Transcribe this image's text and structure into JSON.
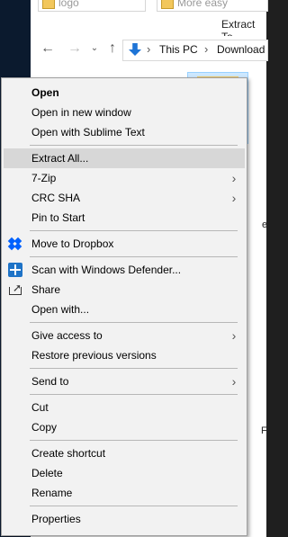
{
  "explorer": {
    "top_files": [
      "logo",
      "More easy"
    ],
    "extract_label": "Extract To",
    "address_crumbs": [
      "This PC",
      "Download"
    ],
    "right_edge_letters": [
      "e",
      "F"
    ]
  },
  "context_menu": {
    "items": [
      {
        "label": "Open",
        "bold": true
      },
      {
        "label": "Open in new window"
      },
      {
        "label": "Open with Sublime Text"
      },
      {
        "label": "Extract All...",
        "highlighted": true
      },
      {
        "label": "7-Zip",
        "submenu": true
      },
      {
        "label": "CRC SHA",
        "submenu": true
      },
      {
        "label": "Pin to Start"
      },
      {
        "label": "Move to Dropbox",
        "icon": "dropbox-icon"
      },
      {
        "label": "Scan with Windows Defender...",
        "icon": "windows-defender-icon"
      },
      {
        "label": "Share",
        "icon": "share-icon"
      },
      {
        "label": "Open with..."
      },
      {
        "label": "Give access to",
        "submenu": true
      },
      {
        "label": "Restore previous versions"
      },
      {
        "label": "Send to",
        "submenu": true
      },
      {
        "label": "Cut"
      },
      {
        "label": "Copy"
      },
      {
        "label": "Create shortcut"
      },
      {
        "label": "Delete"
      },
      {
        "label": "Rename"
      },
      {
        "label": "Properties"
      }
    ]
  },
  "colors": {
    "menu_bg": "#f2f2f2",
    "highlight": "#d7d7d7",
    "divider": "#b7b7b7",
    "dropbox": "#0061fe",
    "defender": "#1e73c7"
  }
}
